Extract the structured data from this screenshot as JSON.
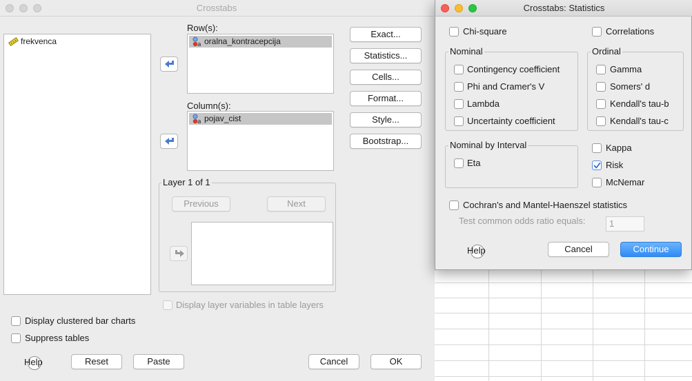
{
  "main": {
    "title": "Crosstabs",
    "source_list": [
      {
        "label": "frekvenca"
      }
    ],
    "rows_label": "Row(s):",
    "rows_items": [
      {
        "label": "oralna_kontracepcija"
      }
    ],
    "columns_label": "Column(s):",
    "columns_items": [
      {
        "label": "pojav_cist"
      }
    ],
    "layer_label": "Layer 1 of 1",
    "previous_label": "Previous",
    "next_label": "Next",
    "side_buttons": {
      "exact": "Exact...",
      "statistics": "Statistics...",
      "cells": "Cells...",
      "format": "Format...",
      "style": "Style...",
      "bootstrap": "Bootstrap..."
    },
    "display_layer_vars": {
      "label": "Display layer variables in table layers",
      "checked": false,
      "enabled": false
    },
    "clustered_bar": {
      "label": "Display clustered bar charts",
      "checked": false
    },
    "suppress_tables": {
      "label": "Suppress tables",
      "checked": false
    },
    "buttons": {
      "help": "Help",
      "reset": "Reset",
      "paste": "Paste",
      "cancel": "Cancel",
      "ok": "OK"
    }
  },
  "stats": {
    "title": "Crosstabs: Statistics",
    "chi_square": {
      "label": "Chi-square",
      "checked": false
    },
    "correlations": {
      "label": "Correlations",
      "checked": false
    },
    "nominal": {
      "title": "Nominal",
      "items": [
        {
          "label": "Contingency coefficient",
          "checked": false
        },
        {
          "label": "Phi and Cramer's V",
          "checked": false
        },
        {
          "label": "Lambda",
          "checked": false
        },
        {
          "label": "Uncertainty coefficient",
          "checked": false
        }
      ]
    },
    "ordinal": {
      "title": "Ordinal",
      "items": [
        {
          "label": "Gamma",
          "checked": false
        },
        {
          "label": "Somers' d",
          "checked": false
        },
        {
          "label": "Kendall's tau-b",
          "checked": false
        },
        {
          "label": "Kendall's tau-c",
          "checked": false
        }
      ]
    },
    "nominal_by_interval": {
      "title": "Nominal by Interval",
      "items": [
        {
          "label": "Eta",
          "checked": false
        }
      ]
    },
    "other": [
      {
        "label": "Kappa",
        "checked": false
      },
      {
        "label": "Risk",
        "checked": true
      },
      {
        "label": "McNemar",
        "checked": false
      }
    ],
    "cochran": {
      "label": "Cochran's and Mantel-Haenszel statistics",
      "checked": false
    },
    "odds_ratio": {
      "label": "Test common odds ratio equals:",
      "value": "1"
    },
    "buttons": {
      "help": "Help",
      "cancel": "Cancel",
      "continue": "Continue"
    }
  },
  "colors": {
    "accent": "#2f8cf7",
    "check": "#2f6fd6",
    "selection": "#c6c6c6"
  },
  "icons": {
    "scale": "ruler-icon",
    "nominal": "nominal-variable-icon",
    "move_arrow": "arrow-left-icon"
  }
}
